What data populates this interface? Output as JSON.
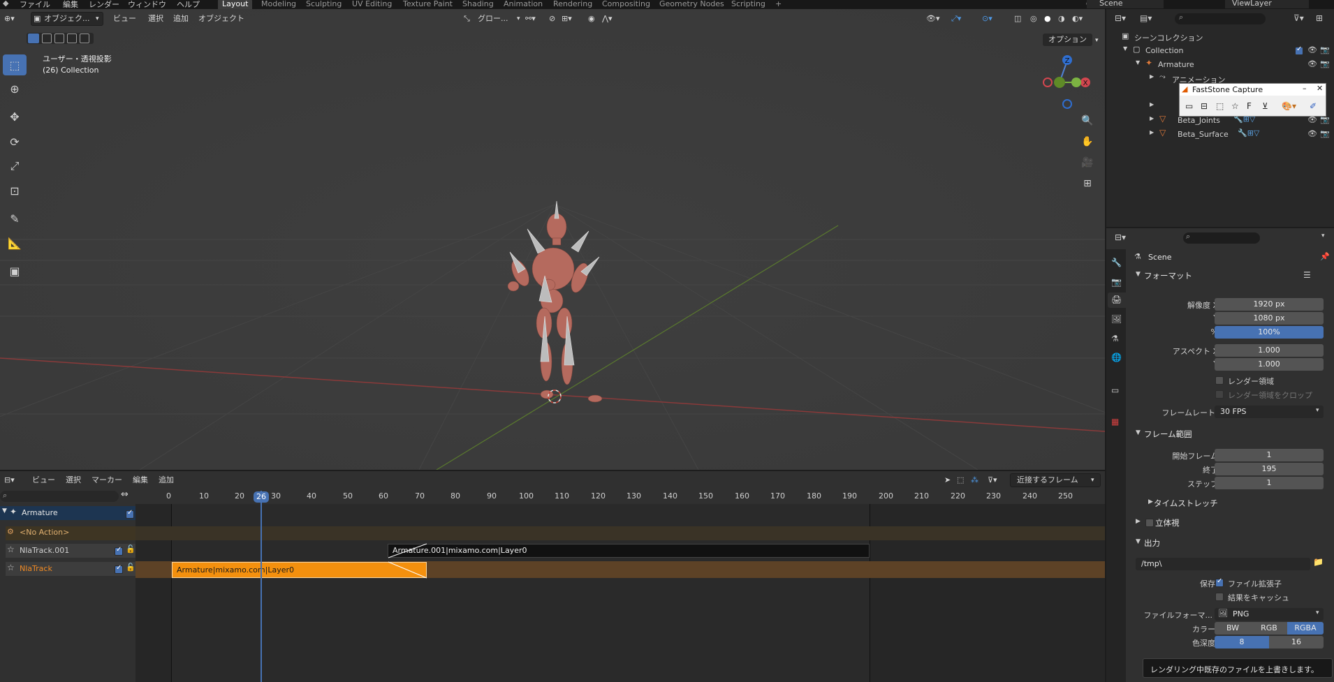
{
  "topbar": {
    "menus": [
      "ファイル",
      "編集",
      "レンダー",
      "ウィンドウ",
      "ヘルプ"
    ],
    "workspaces": [
      "Layout",
      "Modeling",
      "Sculpting",
      "UV Editing",
      "Texture Paint",
      "Shading",
      "Animation",
      "Rendering",
      "Compositing",
      "Geometry Nodes",
      "Scripting"
    ],
    "add_tab": "+",
    "scene": "Scene",
    "view_layer": "ViewLayer"
  },
  "viewport": {
    "mode": "オブジェク...",
    "menus": [
      "ビュー",
      "選択",
      "追加",
      "オブジェクト"
    ],
    "transform_orientation": "グロー...",
    "options_label": "オプション",
    "overlay_title": "ユーザー・透視投影",
    "overlay_sub": "(26) Collection",
    "gizmo": {
      "z": "Z",
      "x": "X",
      "y": "Y"
    }
  },
  "nla": {
    "menus": [
      "ビュー",
      "選択",
      "マーカー",
      "編集",
      "追加"
    ],
    "snap_label": "近接するフレーム",
    "current_frame": "26",
    "ticks": [
      "0",
      "10",
      "20",
      "30",
      "40",
      "50",
      "60",
      "70",
      "80",
      "90",
      "100",
      "110",
      "120",
      "130",
      "140",
      "150",
      "160",
      "170",
      "180",
      "190",
      "200",
      "210",
      "220",
      "230",
      "240",
      "250"
    ],
    "tracks": {
      "armature": "Armature",
      "no_action": "<No Action>",
      "track1": "NlaTrack.001",
      "track0": "NlaTrack"
    },
    "strips": {
      "upper": "Armature.001|mixamo.com|Layer0",
      "lower": "Armature|mixamo.com|Layer0"
    }
  },
  "outliner": {
    "scene_collection": "シーンコレクション",
    "items": [
      "Collection",
      "Armature",
      "アニメーション",
      "Beta_Joints",
      "Beta_Surface"
    ]
  },
  "faststone": {
    "title": "FastStone Capture"
  },
  "properties": {
    "scene_name": "Scene",
    "format_panel": "フォーマット",
    "res_x_label": "解像度 X",
    "res_x": "1920 px",
    "res_y_label": "Y",
    "res_y": "1080 px",
    "pct_label": "%",
    "pct": "100%",
    "aspect_x_label": "アスペクト X",
    "aspect_x": "1.000",
    "aspect_y_label": "Y",
    "aspect_y": "1.000",
    "render_region": "レンダー領域",
    "crop_region": "レンダー領域をクロップ",
    "framerate_label": "フレームレート",
    "framerate": "30 FPS",
    "frame_range_panel": "フレーム範囲",
    "start_label": "開始フレーム",
    "start": "1",
    "end_label": "終了",
    "end": "195",
    "step_label": "ステップ",
    "step": "1",
    "time_stretch": "タイムストレッチ",
    "stereo": "立体視",
    "output_panel": "出力",
    "output_path": "/tmp\\",
    "save_label": "保存",
    "file_ext": "ファイル拡張子",
    "cache_result": "結果をキャッシュ",
    "file_format_label": "ファイルフォーマ...",
    "file_format": "PNG",
    "color_label": "カラー",
    "color_opts": [
      "BW",
      "RGB",
      "RGBA"
    ],
    "depth_label": "色深度",
    "depth_opts": [
      "8",
      "16"
    ],
    "tooltip": "レンダリング中既存のファイルを上書きします。"
  }
}
